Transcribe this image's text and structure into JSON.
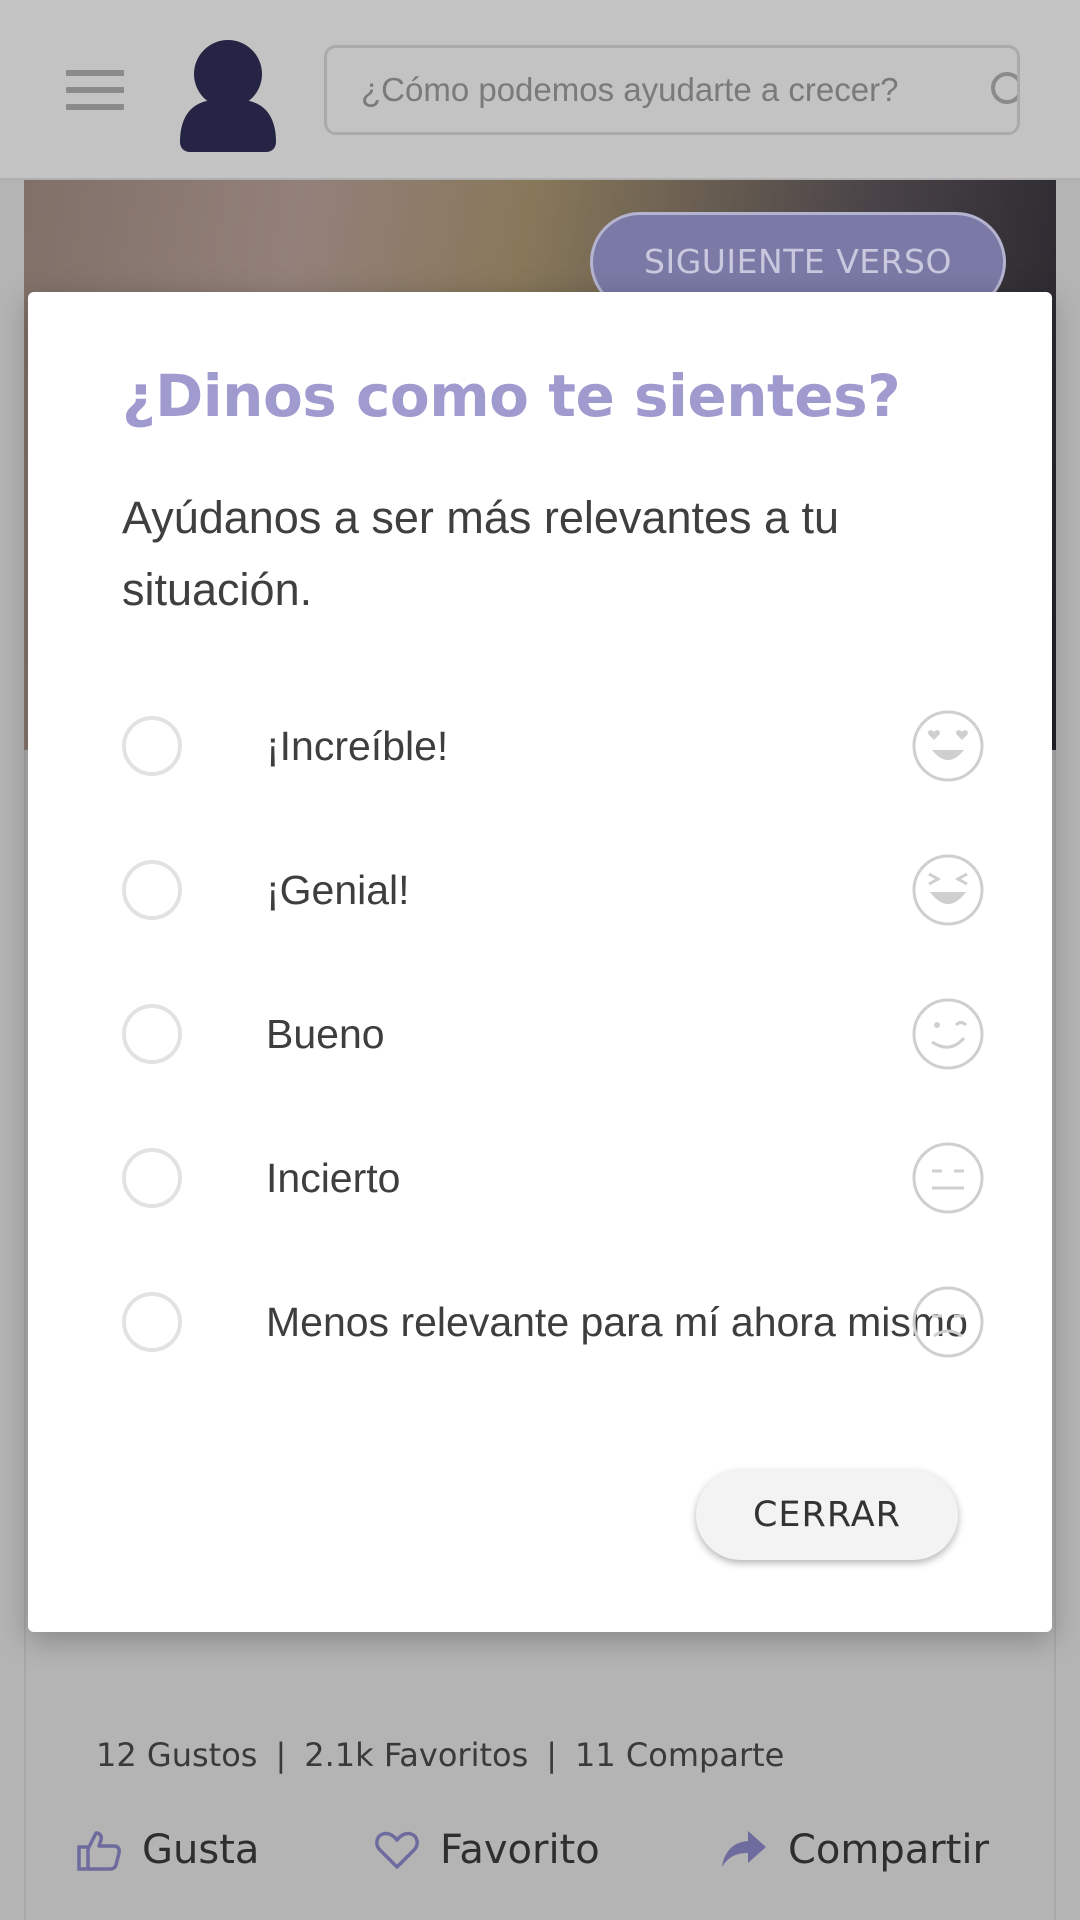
{
  "header": {
    "search_placeholder": "¿Cómo podemos ayudarte a crecer?"
  },
  "hero": {
    "next_button_label": "SIGUIENTE VERSO"
  },
  "stats": {
    "likes": "12 Gustos",
    "favorites": "2.1k Favoritos",
    "shares": "11 Comparte",
    "separator": "|"
  },
  "actions": {
    "like_label": "Gusta",
    "favorite_label": "Favorito",
    "share_label": "Compartir"
  },
  "modal": {
    "title": "¿Dinos como te sientes?",
    "subtitle": "Ayúdanos a ser más relevantes a tu situación.",
    "options": [
      {
        "label": "¡Increíble!",
        "icon": "heart-eyes-face-icon"
      },
      {
        "label": "¡Genial!",
        "icon": "grinning-squinting-face-icon"
      },
      {
        "label": "Bueno",
        "icon": "winking-face-icon"
      },
      {
        "label": "Incierto",
        "icon": "neutral-face-icon"
      },
      {
        "label": "Menos relevante para mí ahora mismo",
        "icon": "sad-face-icon"
      }
    ],
    "close_label": "CERRAR"
  },
  "colors": {
    "accent": "#a09bcf",
    "overlay": "#b4b4b4",
    "button_purple": "#7b7aa6",
    "modal_background": "#ffffff"
  }
}
